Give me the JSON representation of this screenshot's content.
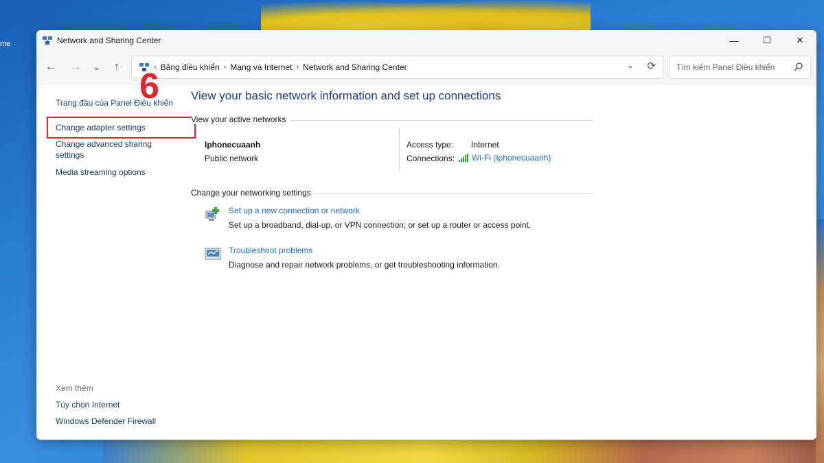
{
  "desktop": {
    "label": "me"
  },
  "window": {
    "title": "Network and Sharing Center"
  },
  "controls": {
    "minimize": "—",
    "maximize": "☐",
    "close": "✕"
  },
  "nav": {
    "back": "←",
    "forward": "→",
    "recent": "⌄",
    "up": "↑",
    "breadcrumbs": [
      "Bảng điều khiển",
      "Mạng và Internet",
      "Network and Sharing Center"
    ],
    "separator": "›",
    "dropdown": "⌄",
    "refresh": "⟳"
  },
  "search": {
    "placeholder": "Tìm kiếm Panel Điều khiển"
  },
  "sidebar": {
    "home": "Trang đầu của Panel Điều khiển",
    "links": [
      "Change adapter settings",
      "Change advanced sharing settings",
      "Media streaming options"
    ],
    "see_also_title": "Xem thêm",
    "see_also": [
      "Tùy chọn Internet",
      "Windows Defender Firewall"
    ]
  },
  "annotation": {
    "step": "6",
    "color": "#e0262d"
  },
  "main": {
    "heading": "View your basic network information and set up connections",
    "active_networks_label": "View your active networks",
    "network": {
      "name": "Iphonecuaanh",
      "type": "Public network",
      "access_type_label": "Access type:",
      "access_type_value": "Internet",
      "connections_label": "Connections:",
      "connections_value": "Wi-Fi (Iphonecuaanh)"
    },
    "change_settings_label": "Change your networking settings",
    "tasks": [
      {
        "link": "Set up a new connection or network",
        "desc": "Set up a broadband, dial-up, or VPN connection; or set up a router or access point.",
        "icon": "new-connection-icon"
      },
      {
        "link": "Troubleshoot problems",
        "desc": "Diagnose and repair network problems, or get troubleshooting information.",
        "icon": "troubleshoot-icon"
      }
    ]
  },
  "colors": {
    "link": "#1a6ec4",
    "heading": "#1e3a8a",
    "annotation": "#e0262d"
  }
}
